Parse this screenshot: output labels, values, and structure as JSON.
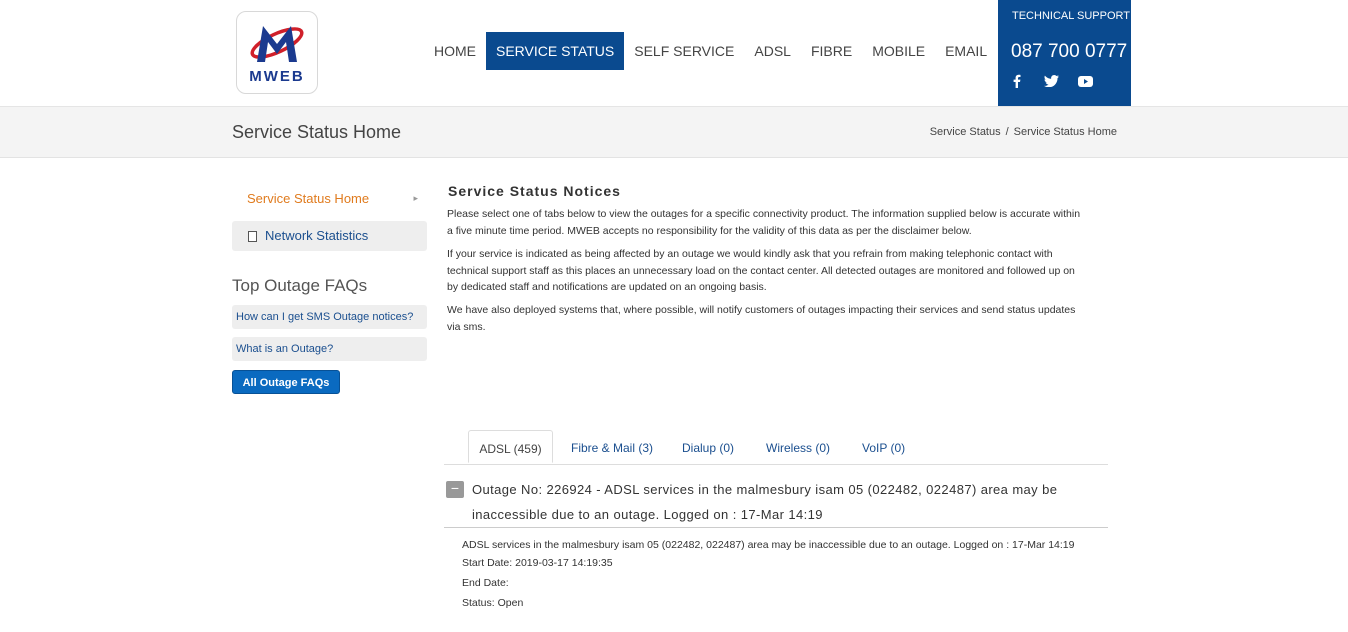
{
  "header": {
    "logo_text": "MWEB",
    "nav": [
      {
        "label": "HOME",
        "active": false
      },
      {
        "label": "SERVICE STATUS",
        "active": true
      },
      {
        "label": "SELF SERVICE",
        "active": false
      },
      {
        "label": "ADSL",
        "active": false
      },
      {
        "label": "FIBRE",
        "active": false
      },
      {
        "label": "MOBILE",
        "active": false
      },
      {
        "label": "EMAIL",
        "active": false
      }
    ],
    "support": {
      "label": "TECHNICAL SUPPORT",
      "phone": "087 700 0777",
      "social_icons": [
        "facebook-icon",
        "twitter-icon",
        "youtube-icon"
      ]
    }
  },
  "titlebar": {
    "title": "Service Status Home",
    "breadcrumb": [
      "Service Status",
      "Service Status Home"
    ],
    "breadcrumb_separator": "/"
  },
  "sidebar": {
    "links": [
      {
        "label": "Service Status Home",
        "active": true
      },
      {
        "label": "Network Statistics",
        "active": false
      }
    ],
    "faq_title": "Top Outage FAQs",
    "faqs": [
      "How can I get SMS Outage notices?",
      "What is an Outage?"
    ],
    "faq_button": "All Outage FAQs"
  },
  "main": {
    "title": "Service Status Notices",
    "paragraphs": [
      "Please select one of tabs below to view the outages for a specific connectivity product. The information supplied below is accurate within a five minute time period. MWEB accepts no responsibility for the validity of this data as per the disclaimer below.",
      "If your service is indicated as being affected by an outage we would kindly ask that you refrain from making telephonic contact with technical support staff as this places an unnecessary load on the contact center.  All detected outages are monitored and followed up on by dedicated staff and notifications are updated on an ongoing basis.",
      "We have also deployed systems that, where possible,  will  notify customers of outages impacting their services and send status updates via sms."
    ],
    "tabs": [
      {
        "label": "ADSL (459)",
        "active": true
      },
      {
        "label": "Fibre & Mail (3)",
        "active": false
      },
      {
        "label": "Dialup (0)",
        "active": false
      },
      {
        "label": "Wireless (0)",
        "active": false
      },
      {
        "label": "VoIP (0)",
        "active": false
      }
    ],
    "outage": {
      "toggle": "−",
      "heading": "Outage No: 226924 - ADSL services in the malmesbury isam 05 (022482, 022487) area may be inaccessible due to an outage. Logged on : 17-Mar 14:19",
      "description": "ADSL services in the malmesbury isam 05 (022482, 022487) area may be inaccessible due to an outage. Logged on : 17-Mar 14:19",
      "start_date": "Start Date: 2019-03-17 14:19:35",
      "end_date": "End Date:",
      "status": "Status: Open"
    }
  },
  "colors": {
    "brand_blue": "#0a4a8f",
    "active_link_orange": "#e07b1e",
    "link_blue": "#1b4f8f",
    "button_blue": "#0a6ac0"
  }
}
